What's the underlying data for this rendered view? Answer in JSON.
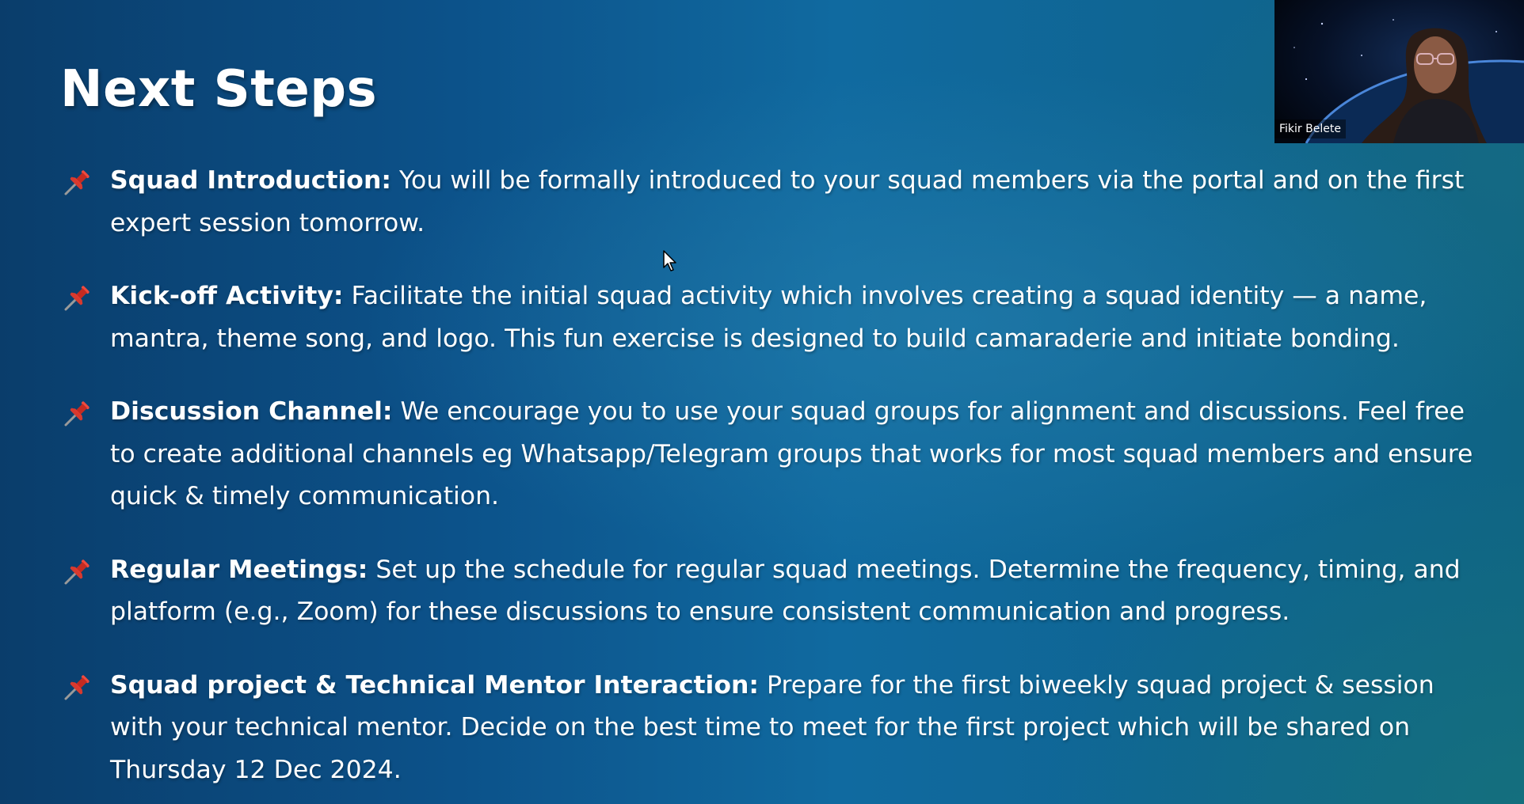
{
  "slide": {
    "title": "Next Steps",
    "steps": [
      {
        "heading": "Squad Introduction:",
        "body": " You will be formally introduced to your squad members via the portal and on the first expert session tomorrow.",
        "icon": "pushpin-icon"
      },
      {
        "heading": "Kick-off Activity:",
        "body": " Facilitate the initial squad activity which involves creating a squad identity — a name, mantra, theme song, and logo. This fun exercise is designed to build camaraderie and initiate bonding.",
        "icon": "pushpin-icon"
      },
      {
        "heading": "Discussion Channel:",
        "body": " We encourage you to use your squad groups for alignment and discussions. Feel free to create additional channels eg Whatsapp/Telegram groups that works for most squad members and ensure quick & timely communication.",
        "icon": "pushpin-icon"
      },
      {
        "heading": "Regular Meetings:",
        "body": " Set up the schedule for regular squad meetings. Determine the frequency, timing, and platform (e.g., Zoom) for these discussions to ensure consistent communication and progress.",
        "icon": "pushpin-icon"
      },
      {
        "heading": "Squad project & Technical Mentor Interaction:",
        "body": " Prepare for the first biweekly squad project & session with your technical mentor. Decide on the best time to meet for the first project which will be shared on Thursday 12 Dec 2024.",
        "icon": "pushpin-icon"
      }
    ]
  },
  "video": {
    "participant_name": "Fikir Belete"
  },
  "colors": {
    "background_left": "#0a3d6b",
    "background_mid": "#106aa0",
    "background_right": "#0f6484",
    "text": "#ffffff",
    "pin_red": "#d63a2f"
  }
}
